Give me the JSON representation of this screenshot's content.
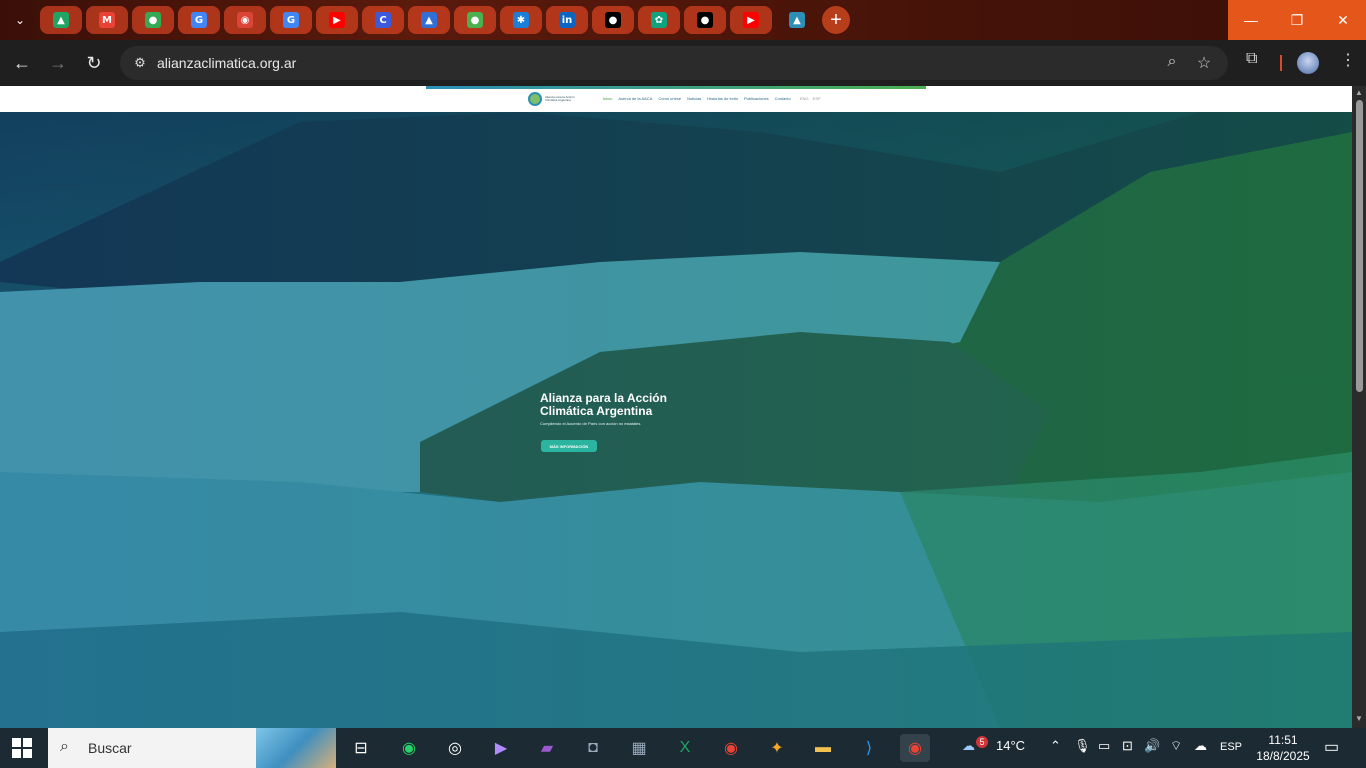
{
  "browser": {
    "url": "alianzaclimatica.org.ar",
    "pinned_tabs": [
      {
        "name": "google-drive",
        "color": "#1fa463",
        "glyph": "▲"
      },
      {
        "name": "gmail",
        "color": "#ea4335",
        "glyph": "M"
      },
      {
        "name": "google-maps",
        "color": "#34a853",
        "glyph": "●"
      },
      {
        "name": "google-translate",
        "color": "#4285f4",
        "glyph": "G"
      },
      {
        "name": "chrome",
        "color": "#db4437",
        "glyph": "◉"
      },
      {
        "name": "google",
        "color": "#4285f4",
        "glyph": "G"
      },
      {
        "name": "youtube",
        "color": "#ff0000",
        "glyph": "▶"
      },
      {
        "name": "app-c",
        "color": "#3b5bdb",
        "glyph": "C"
      },
      {
        "name": "app-triangle",
        "color": "#2f6fd6",
        "glyph": "▲"
      },
      {
        "name": "app-globe",
        "color": "#4caf50",
        "glyph": "●"
      },
      {
        "name": "app-asterisk",
        "color": "#1c7ed6",
        "glyph": "✱"
      },
      {
        "name": "linkedin",
        "color": "#0a66c2",
        "glyph": "in"
      },
      {
        "name": "github",
        "color": "#000000",
        "glyph": "●"
      },
      {
        "name": "chatgpt",
        "color": "#10a37f",
        "glyph": "✿"
      },
      {
        "name": "github-2",
        "color": "#000000",
        "glyph": "●"
      },
      {
        "name": "youtube-2",
        "color": "#ff0000",
        "glyph": "▶"
      },
      {
        "name": "alianza-climatica",
        "color": "#2d8fb5",
        "glyph": "▲"
      }
    ]
  },
  "site": {
    "logo_text": "Alianza para la Acción Climática Argentina",
    "menu": [
      "Inicio",
      "Acerca de la AACA",
      "Cómo unirse",
      "Noticias",
      "Historias de éxito",
      "Publicaciones",
      "Contacto"
    ],
    "menu_extra": [
      "ENG",
      "ESP"
    ],
    "hero_title": "Alianza para la Acción Climática Argentina",
    "hero_subtitle": "Cumpliendo el Acuerdo de París con acción no estatales.",
    "hero_button": "MÁS INFORMACIÓN"
  },
  "taskbar": {
    "search_placeholder": "Buscar",
    "weather_badge": "5",
    "temperature": "14°C",
    "language": "ESP",
    "time": "11:51",
    "date": "18/8/2025"
  }
}
